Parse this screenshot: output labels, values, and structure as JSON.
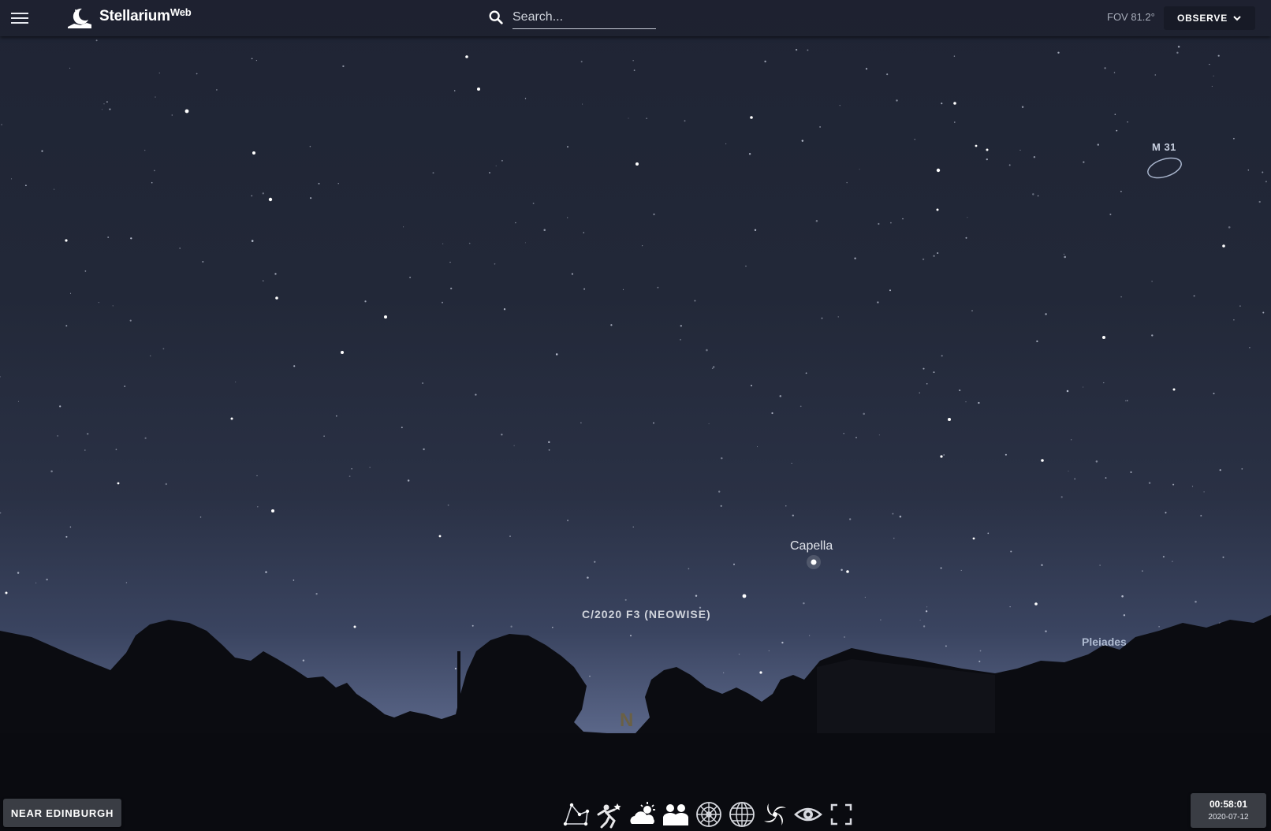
{
  "app": {
    "brand_name": "Stellarium",
    "brand_suffix": "Web"
  },
  "search": {
    "placeholder": "Search..."
  },
  "header": {
    "fov_label": "FOV 81.2°",
    "observe_label": "OBSERVE"
  },
  "sky_labels": {
    "capella": "Capella",
    "comet": "C/2020 F3 (NEOWISE)",
    "m31": "M 31",
    "pleiades": "Pleiades",
    "north": "N"
  },
  "footer": {
    "location_label": "NEAR EDINBURGH",
    "time": "00:58:01",
    "date": "2020-07-12"
  },
  "toolbar": {
    "icons": [
      "constellation-lines-icon",
      "constellation-art-icon",
      "atmosphere-icon",
      "landscape-icon",
      "azimuthal-grid-icon",
      "equatorial-grid-icon",
      "deep-sky-objects-icon",
      "night-mode-icon",
      "fullscreen-icon"
    ]
  },
  "colors": {
    "topbar": "#1e2230",
    "button_bg": "#3a3d44",
    "sky_top": "#1f2434",
    "sky_horizon": "#5a6688"
  }
}
